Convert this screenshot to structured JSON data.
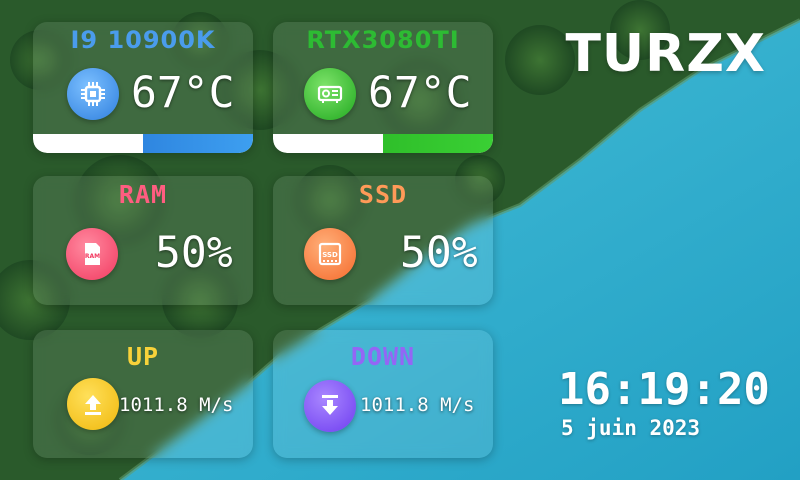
{
  "brand": "TURZX",
  "clock": {
    "time": "16:19:20",
    "date": "5 juin 2023"
  },
  "colors": {
    "cpu_accent": "#3d8fe0",
    "gpu_accent": "#34c233",
    "ram_accent": "#ff5d7a",
    "ssd_accent": "#ff8a4c",
    "up_accent": "#f6c926",
    "down_accent": "#8a5cf5"
  },
  "cpu": {
    "label": "I9 10900K",
    "temperature": "67°C",
    "icon": "cpu-chip-icon",
    "usage_fraction": 0.5
  },
  "gpu": {
    "label": "RTX3080TI",
    "temperature": "67°C",
    "icon": "gpu-card-icon",
    "usage_fraction": 0.5
  },
  "ram": {
    "label": "RAM",
    "usage": "50%",
    "icon": "ram-card-icon"
  },
  "ssd": {
    "label": "SSD",
    "usage": "50%",
    "icon": "ssd-drive-icon"
  },
  "upload": {
    "label": "UP",
    "speed": "1011.8 M/s",
    "icon": "upload-arrow-icon"
  },
  "download": {
    "label": "DOWN",
    "speed": "1011.8 M/s",
    "icon": "download-arrow-icon"
  }
}
